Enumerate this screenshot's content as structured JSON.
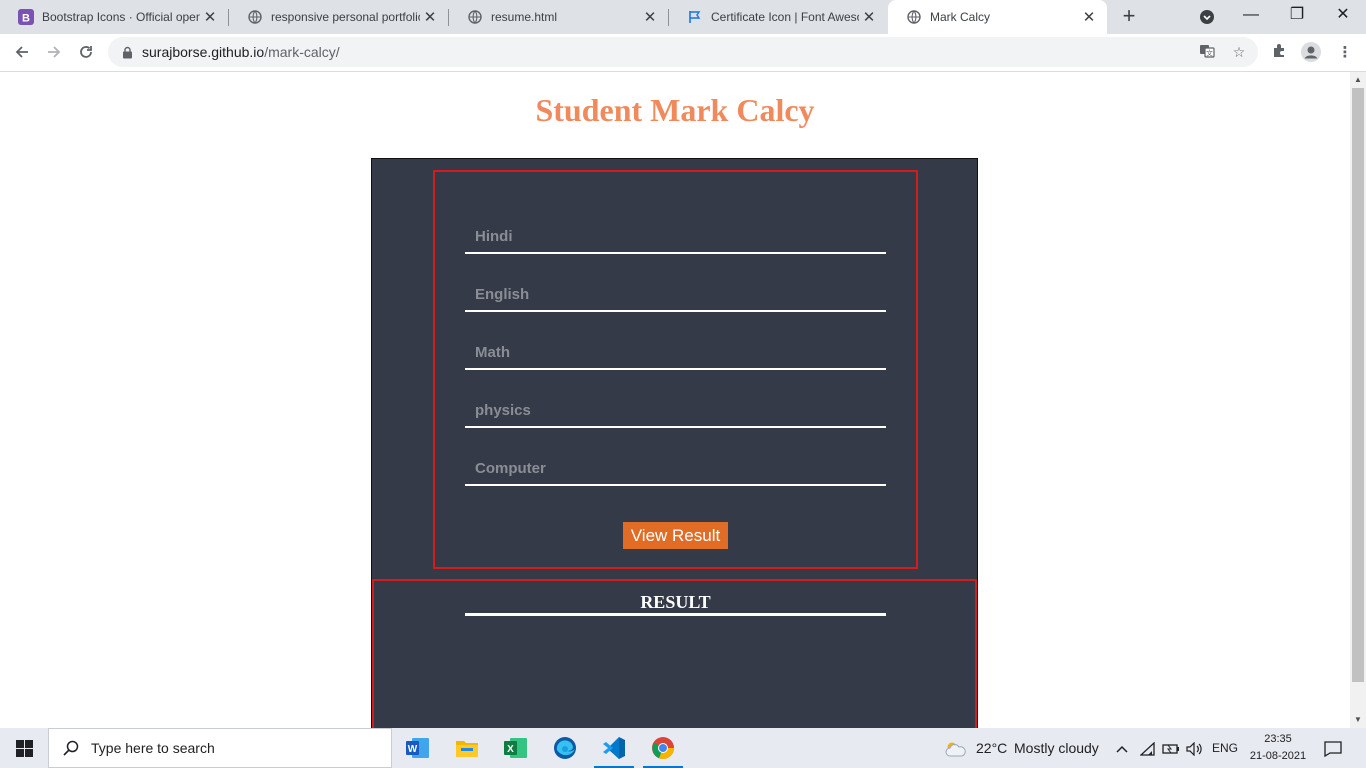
{
  "browser": {
    "tabs": [
      {
        "title": "Bootstrap Icons · Official open source SVG icon library",
        "favicon": "bootstrap-icon"
      },
      {
        "title": "responsive personal portfolio",
        "favicon": "globe-icon"
      },
      {
        "title": "resume.html",
        "favicon": "globe-icon"
      },
      {
        "title": "Certificate Icon | Font Awesome",
        "favicon": "flag-icon"
      },
      {
        "title": "Mark Calcy",
        "favicon": "globe-icon"
      }
    ],
    "url_host": "surajborse.github.io",
    "url_path": "/mark-calcy/"
  },
  "page": {
    "title": "Student Mark Calcy",
    "fields": [
      {
        "placeholder": "Hindi",
        "value": ""
      },
      {
        "placeholder": "English",
        "value": ""
      },
      {
        "placeholder": "Math",
        "value": ""
      },
      {
        "placeholder": "physics",
        "value": ""
      },
      {
        "placeholder": "Computer",
        "value": ""
      }
    ],
    "button_label": "View Result",
    "result_title": "RESULT"
  },
  "taskbar": {
    "search_placeholder": "Type here to search",
    "weather_temp": "22°C",
    "weather_text": "Mostly cloudy",
    "language": "ENG",
    "time": "23:35",
    "date": "21-08-2021"
  },
  "colors": {
    "title": "#f08a5d",
    "card": "#343a48",
    "border_red": "#d41c1c",
    "button": "#e06c25"
  }
}
